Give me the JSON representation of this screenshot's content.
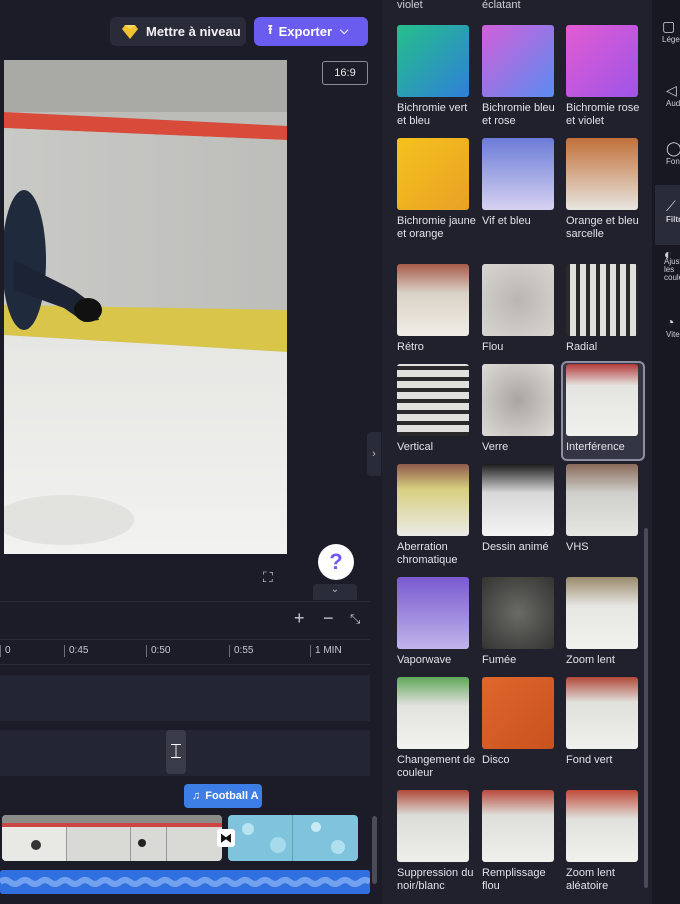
{
  "header": {
    "upgrade_label": "Mettre à niveau",
    "export_label": "Exporter",
    "colors": {
      "upgrade_bg": "#2a2b38",
      "export_bg": "#6b5cf0",
      "gem": "#f2c230"
    }
  },
  "preview": {
    "aspect_ratio": "16:9",
    "help_glyph": "?",
    "fullscreen_icon": "fullscreen-icon"
  },
  "timeline": {
    "zoom_in_icon": "plus-icon",
    "zoom_out_icon": "minus-icon",
    "fit_icon": "fit-to-screen-icon",
    "ticks": [
      "0",
      "0:45",
      "0:50",
      "0:55",
      "1 MIN"
    ],
    "music_clip_label": "Football A",
    "colors": {
      "music_clip": "#3d7de6",
      "audio_track": "#2f6fe0"
    }
  },
  "filters": {
    "top_partial_labels": [
      "violet",
      "éclatant"
    ],
    "items": [
      {
        "label": "Bichromie vert et bleu",
        "selected": false
      },
      {
        "label": "Bichromie bleu et rose",
        "selected": false
      },
      {
        "label": "Bichromie rose et violet",
        "selected": false
      },
      {
        "label": "Bichromie jaune et orange",
        "selected": false
      },
      {
        "label": "Vif et bleu",
        "selected": false
      },
      {
        "label": "Orange et bleu sarcelle",
        "selected": false
      },
      {
        "label": "Rétro",
        "selected": false
      },
      {
        "label": "Flou",
        "selected": false
      },
      {
        "label": "Radial",
        "selected": false
      },
      {
        "label": "Vertical",
        "selected": false
      },
      {
        "label": "Verre",
        "selected": false
      },
      {
        "label": "Interférence",
        "selected": true
      },
      {
        "label": "Aberration chromatique",
        "selected": false
      },
      {
        "label": "Dessin animé",
        "selected": false
      },
      {
        "label": "VHS",
        "selected": false
      },
      {
        "label": "Vaporwave",
        "selected": false
      },
      {
        "label": "Fumée",
        "selected": false
      },
      {
        "label": "Zoom lent",
        "selected": false
      },
      {
        "label": "Changement de couleur",
        "selected": false
      },
      {
        "label": "Disco",
        "selected": false
      },
      {
        "label": "Fond vert",
        "selected": false
      },
      {
        "label": "Suppression du noir/blanc",
        "selected": false
      },
      {
        "label": "Remplissage flou",
        "selected": false
      },
      {
        "label": "Zoom lent aléatoire",
        "selected": false
      }
    ]
  },
  "side_rail": {
    "items": [
      {
        "label": "Légendes",
        "icon": "captions-icon"
      },
      {
        "label": "Audio",
        "icon": "speaker-icon"
      },
      {
        "label": "Fondu",
        "icon": "fade-icon"
      },
      {
        "label": "Filtres",
        "icon": "magic-wand-icon",
        "active": true
      },
      {
        "label": "Ajuster les couleurs",
        "icon": "adjust-icon"
      },
      {
        "label": "Vitesse",
        "icon": "speed-icon"
      }
    ]
  }
}
